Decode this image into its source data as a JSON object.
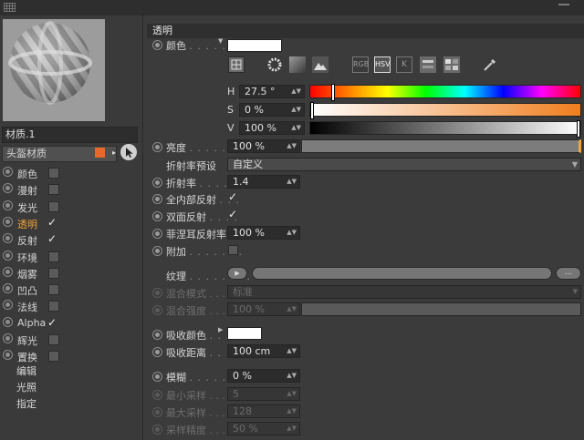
{
  "left": {
    "material_name": "材质.1",
    "material_row_label": "头盔材质",
    "channels": [
      {
        "label": "颜色",
        "checked": false,
        "active": false
      },
      {
        "label": "漫射",
        "checked": false,
        "active": false
      },
      {
        "label": "发光",
        "checked": false,
        "active": false
      },
      {
        "label": "透明",
        "checked": true,
        "active": true
      },
      {
        "label": "反射",
        "checked": true,
        "active": false
      },
      {
        "label": "环境",
        "checked": false,
        "active": false
      },
      {
        "label": "烟雾",
        "checked": false,
        "active": false
      },
      {
        "label": "凹凸",
        "checked": false,
        "active": false
      },
      {
        "label": "法线",
        "checked": false,
        "active": false
      },
      {
        "label": "Alpha",
        "checked": true,
        "active": false
      },
      {
        "label": "辉光",
        "checked": false,
        "active": false
      },
      {
        "label": "置换",
        "checked": false,
        "active": false
      }
    ],
    "sub_items": [
      "编辑",
      "光照",
      "指定"
    ]
  },
  "right": {
    "section_title": "透明",
    "color_label": "颜色",
    "color_swatch": "#ffffff",
    "mode_icons": [
      "color-wheel",
      "spectrum",
      "picture",
      "RGB",
      "HSV",
      "K",
      "mixer",
      "palette",
      "eyedropper"
    ],
    "mode_labels": {
      "rgb": "RGB",
      "hsv": "HSV",
      "k": "K"
    },
    "h_label": "H",
    "h_value": "27.5 °",
    "s_label": "S",
    "s_value": "0 %",
    "v_label": "V",
    "v_value": "100 %",
    "hue_position": 0.0764,
    "brightness_label": "亮度",
    "brightness_value": "100 %",
    "ior_preset_label": "折射率预设",
    "ior_preset_value": "自定义",
    "ior_label": "折射率",
    "ior_value": "1.4",
    "total_internal_label": "全内部反射",
    "total_internal_checked": true,
    "double_sided_label": "双面反射",
    "double_sided_checked": true,
    "fresnel_label": "菲涅耳反射率",
    "fresnel_value": "100 %",
    "additive_label": "附加",
    "additive_checked": false,
    "texture_label": "纹理",
    "texture_more": "...",
    "mix_mode_label": "混合模式",
    "mix_mode_value": "标准",
    "mix_strength_label": "混合强度",
    "mix_strength_value": "100 %",
    "absorb_color_label": "吸收颜色",
    "absorb_color_swatch": "#ffffff",
    "absorb_dist_label": "吸收距离",
    "absorb_dist_value": "100 cm",
    "blur_label": "模糊",
    "blur_value": "0 %",
    "min_samples_label": "最小采样",
    "min_samples_value": "5",
    "max_samples_label": "最大采样",
    "max_samples_value": "128",
    "accuracy_label": "采样精度",
    "accuracy_value": "50 %"
  },
  "colors": {
    "accent": "#f0a43a",
    "material_swatch": "#e8682a",
    "saturation_bar_end": "#f08020"
  }
}
